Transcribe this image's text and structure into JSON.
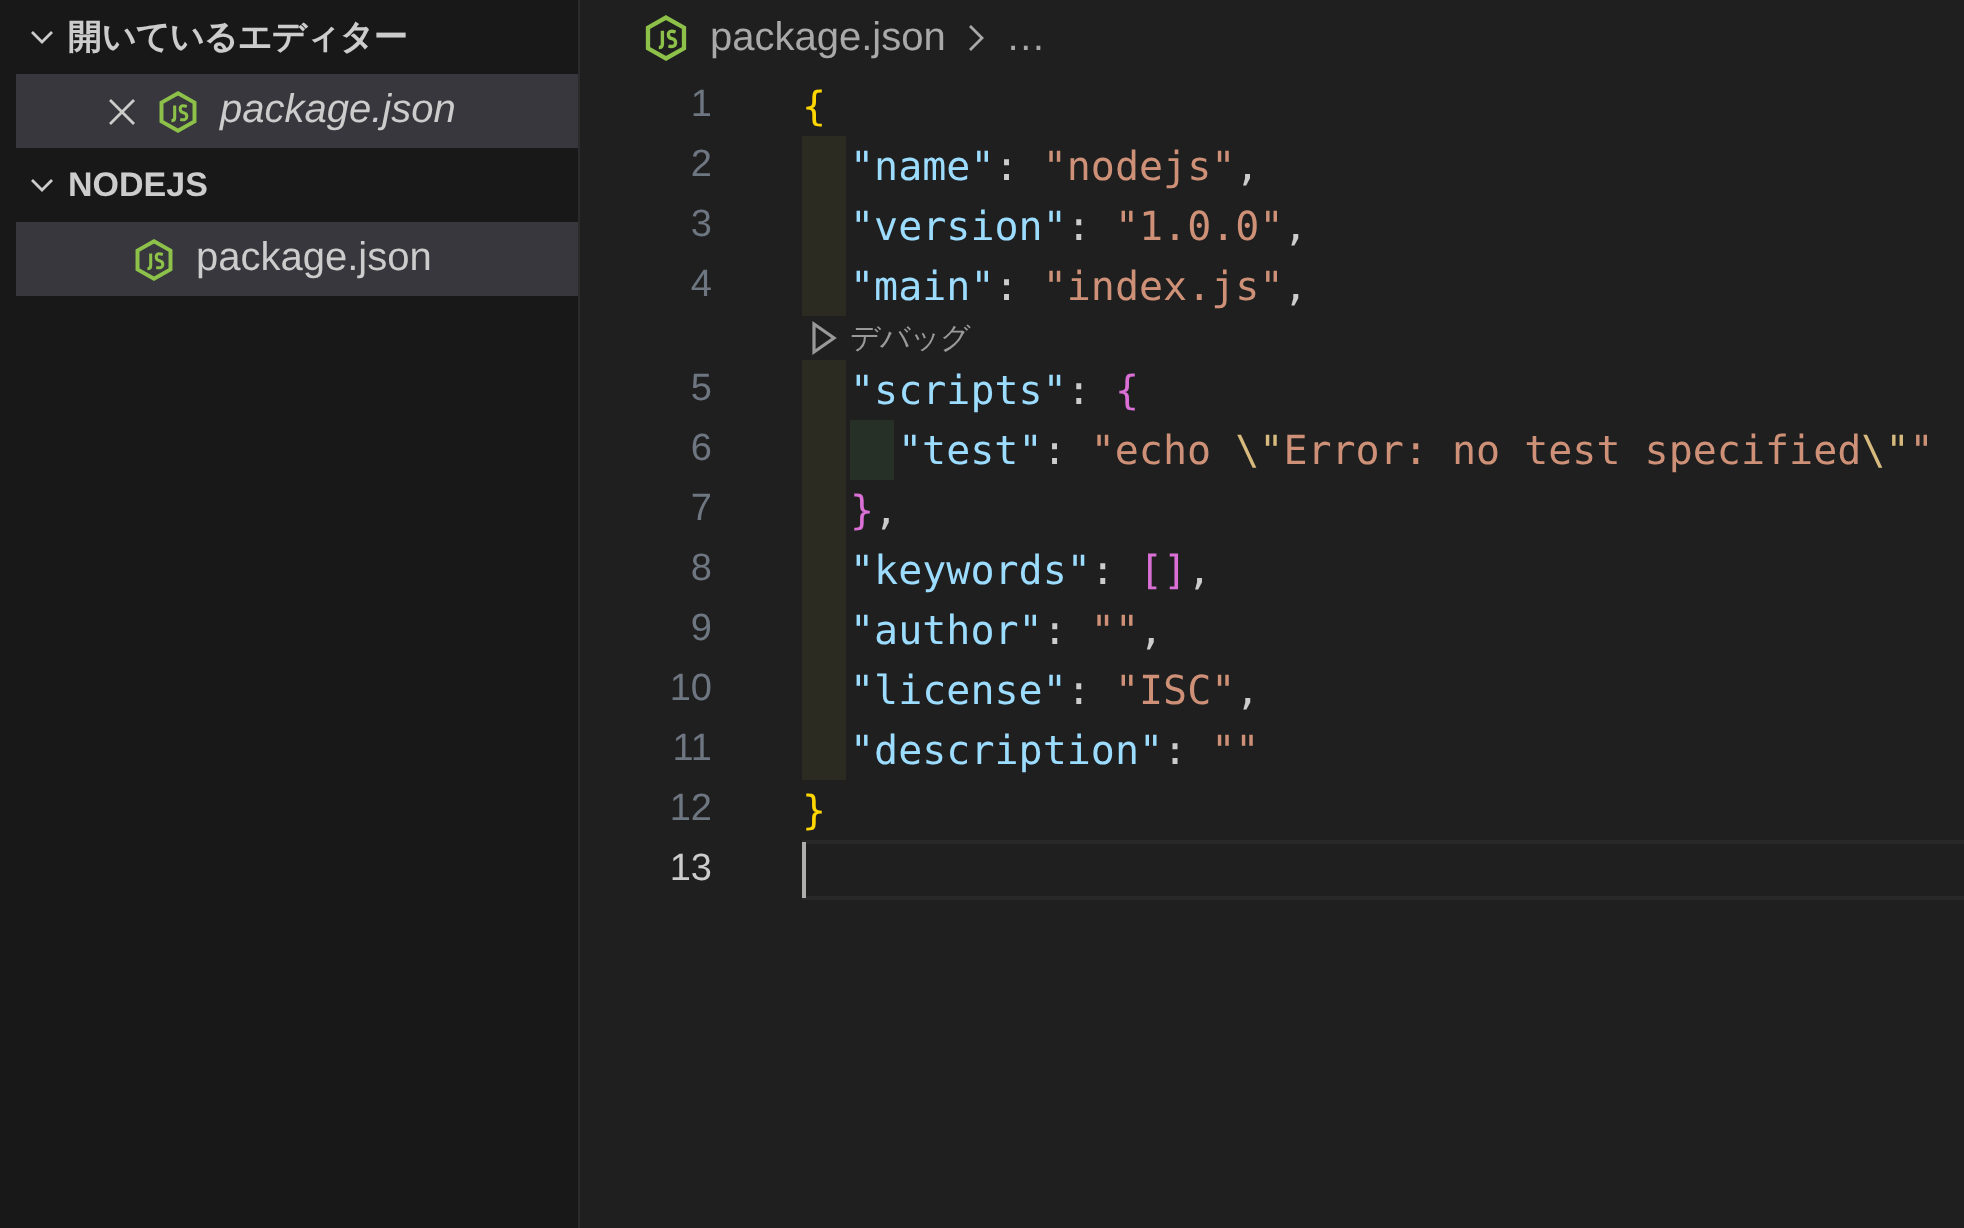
{
  "sidebar": {
    "sections": [
      {
        "title": "開いているエディター",
        "expanded": true,
        "items": [
          {
            "label": "package.json",
            "selected": true,
            "preview": true,
            "closable": true
          }
        ]
      },
      {
        "title": "NODEJS",
        "expanded": true,
        "items": [
          {
            "label": "package.json",
            "selected": true,
            "preview": false,
            "closable": false
          }
        ]
      }
    ]
  },
  "editor": {
    "breadcrumb": [
      "package.json",
      "…"
    ],
    "lines": [
      {
        "kind": "code",
        "number": "1",
        "current": false,
        "tokens": [
          {
            "kind": "brace1",
            "text": "{"
          }
        ],
        "children": [
          {
            "kind": "code",
            "number": "2",
            "current": false,
            "tokens": [
              {
                "kind": "key",
                "text": "\"name\""
              },
              {
                "kind": "punct",
                "text": ": "
              },
              {
                "kind": "string",
                "text": "\"nodejs\""
              },
              {
                "kind": "punct",
                "text": ","
              }
            ]
          },
          {
            "kind": "code",
            "number": "3",
            "current": false,
            "tokens": [
              {
                "kind": "key",
                "text": "\"version\""
              },
              {
                "kind": "punct",
                "text": ": "
              },
              {
                "kind": "string",
                "text": "\"1.0.0\""
              },
              {
                "kind": "punct",
                "text": ","
              }
            ]
          },
          {
            "kind": "code",
            "number": "4",
            "current": false,
            "tokens": [
              {
                "kind": "key",
                "text": "\"main\""
              },
              {
                "kind": "punct",
                "text": ": "
              },
              {
                "kind": "string",
                "text": "\"index.js\""
              },
              {
                "kind": "punct",
                "text": ","
              }
            ]
          },
          {
            "kind": "codelens",
            "label": "デバッグ"
          },
          {
            "kind": "code",
            "number": "5",
            "current": false,
            "tokens": [
              {
                "kind": "key",
                "text": "\"scripts\""
              },
              {
                "kind": "punct",
                "text": ": "
              },
              {
                "kind": "brace2",
                "text": "{"
              }
            ],
            "children": [
              {
                "kind": "code",
                "number": "6",
                "current": false,
                "tokens": [
                  {
                    "kind": "key",
                    "text": "\"test\""
                  },
                  {
                    "kind": "punct",
                    "text": ": "
                  },
                  {
                    "kind": "string",
                    "text": "\"echo "
                  },
                  {
                    "kind": "escape",
                    "text": "\\\""
                  },
                  {
                    "kind": "string",
                    "text": "Error: no test specified"
                  },
                  {
                    "kind": "escape",
                    "text": "\\\""
                  },
                  {
                    "kind": "string",
                    "text": "\""
                  }
                ]
              }
            ]
          },
          {
            "kind": "code",
            "number": "7",
            "current": false,
            "tokens": [
              {
                "kind": "brace2",
                "text": "}"
              },
              {
                "kind": "punct",
                "text": ","
              }
            ]
          },
          {
            "kind": "code",
            "number": "8",
            "current": false,
            "tokens": [
              {
                "kind": "key",
                "text": "\"keywords\""
              },
              {
                "kind": "punct",
                "text": ": "
              },
              {
                "kind": "brace2",
                "text": "[]"
              },
              {
                "kind": "punct",
                "text": ","
              }
            ]
          },
          {
            "kind": "code",
            "number": "9",
            "current": false,
            "tokens": [
              {
                "kind": "key",
                "text": "\"author\""
              },
              {
                "kind": "punct",
                "text": ": "
              },
              {
                "kind": "string",
                "text": "\"\""
              },
              {
                "kind": "punct",
                "text": ","
              }
            ]
          },
          {
            "kind": "code",
            "number": "10",
            "current": false,
            "tokens": [
              {
                "kind": "key",
                "text": "\"license\""
              },
              {
                "kind": "punct",
                "text": ": "
              },
              {
                "kind": "string",
                "text": "\"ISC\""
              },
              {
                "kind": "punct",
                "text": ","
              }
            ]
          },
          {
            "kind": "code",
            "number": "11",
            "current": false,
            "tokens": [
              {
                "kind": "key",
                "text": "\"description\""
              },
              {
                "kind": "punct",
                "text": ": "
              },
              {
                "kind": "string",
                "text": "\"\""
              }
            ]
          }
        ]
      },
      {
        "kind": "code",
        "number": "12",
        "current": false,
        "tokens": [
          {
            "kind": "brace1",
            "text": "}"
          }
        ]
      },
      {
        "kind": "code",
        "number": "13",
        "current": true
      }
    ]
  }
}
